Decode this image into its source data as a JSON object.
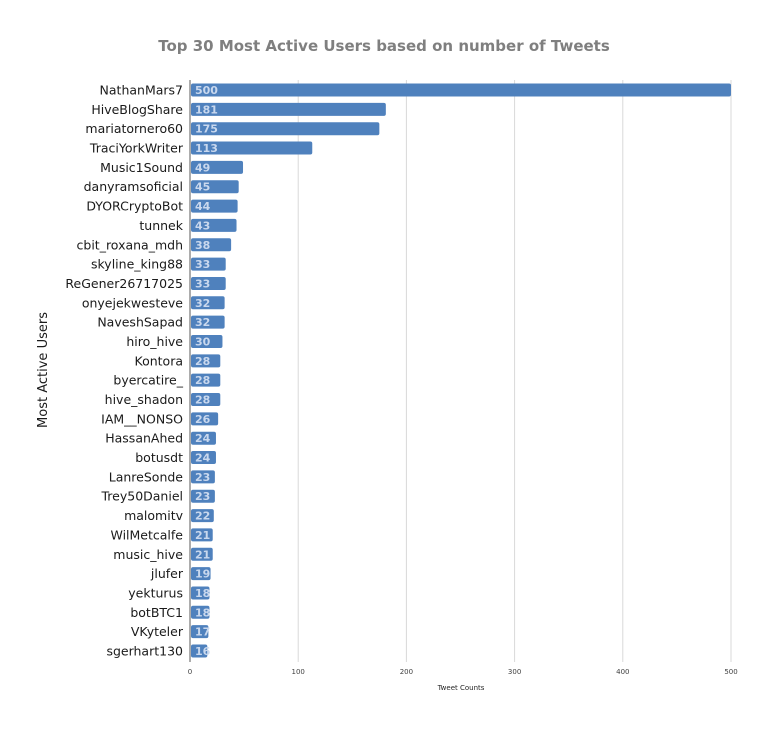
{
  "chart_data": {
    "type": "bar",
    "orientation": "horizontal",
    "title": "Top 30 Most Active Users based on number of Tweets",
    "xlabel": "Tweet Counts",
    "ylabel": "Most Active Users",
    "xlim": [
      0,
      500
    ],
    "xticks": [
      0,
      100,
      200,
      300,
      400,
      500
    ],
    "grid": true,
    "legend": "none",
    "bar_color": "#4f81bd",
    "categories": [
      "NathanMars7",
      "HiveBlogShare",
      "mariatornero60",
      "TraciYorkWriter",
      "Music1Sound",
      "danyramsoficial",
      "DYORCryptoBot",
      "tunnek",
      "cbit_roxana_mdh",
      "skyline_king88",
      "ReGener26717025",
      "onyejekwesteve",
      "NaveshSapad",
      "hiro_hive",
      "Kontora",
      "byercatire_",
      "hive_shadon",
      "IAM__NONSO",
      "HassanAhed",
      "botusdt",
      "LanreSonde",
      "Trey50Daniel",
      "malomitv",
      "WilMetcalfe",
      "music_hive",
      "jlufer",
      "yekturus",
      "botBTC1",
      "VKyteler",
      "sgerhart130"
    ],
    "values": [
      500,
      181,
      175,
      113,
      49,
      45,
      44,
      43,
      38,
      33,
      33,
      32,
      32,
      30,
      28,
      28,
      28,
      26,
      24,
      24,
      23,
      23,
      22,
      21,
      21,
      19,
      18,
      18,
      17,
      16
    ]
  }
}
